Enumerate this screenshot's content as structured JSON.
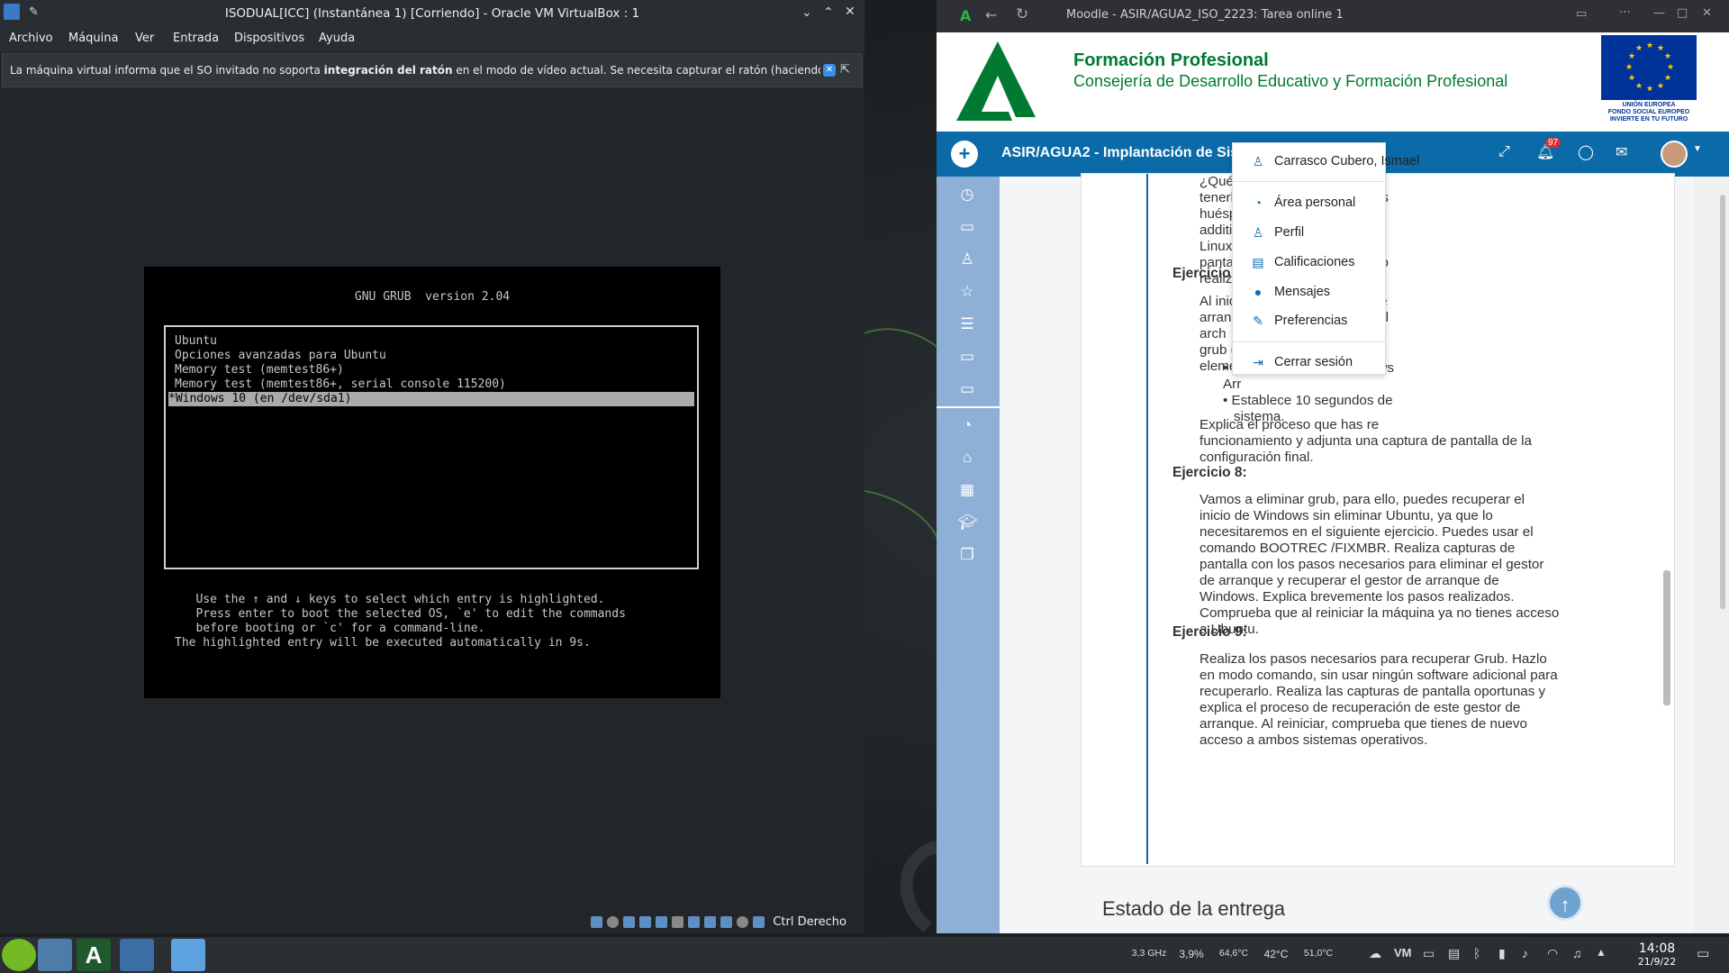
{
  "vbox": {
    "title": "ISODUAL[ICC] (Instantánea 1) [Corriendo] - Oracle VM VirtualBox : 1",
    "menu": [
      "Archivo",
      "Máquina",
      "Ver",
      "Entrada",
      "Dispositivos",
      "Ayuda"
    ],
    "notice_pre": "La máquina virtual informa que el SO invitado no soporta ",
    "notice_bold": "integración del ratón",
    "notice_post": " en el modo de vídeo actual. Se necesita capturar el ratón (haciendo clic sobre la",
    "host_key": "Ctrl Derecho"
  },
  "grub": {
    "header": "GNU GRUB  version 2.04",
    "entries": [
      "Ubuntu",
      "Opciones avanzadas para Ubuntu",
      "Memory test (memtest86+)",
      "Memory test (memtest86+, serial console 115200)",
      "*Windows 10 (en /dev/sda1)"
    ],
    "selected_index": 4,
    "help_lines": [
      "   Use the ↑ and ↓ keys to select which entry is highlighted.",
      "   Press enter to boot the selected OS, `e' to edit the commands",
      "   before booting or `c' for a command-line.",
      "The highlighted entry will be executed automatically in 9s."
    ]
  },
  "browser": {
    "title": "Moodle - ASIR/AGUA2_ISO_2223: Tarea online 1",
    "org_title": "Formación Profesional",
    "org_subtitle": "Consejería de Desarrollo Educativo y Formación Profesional",
    "eu_text_1": "UNIÓN EUROPEA",
    "eu_text_2": "FONDO SOCIAL EUROPEO",
    "eu_text_3": "INVIERTE EN TU FUTURO",
    "course": "ASIR/AGUA2 - Implantación de Sistemas Operativos",
    "notif_count": "97",
    "colors": {
      "nav": "#0b6aa8",
      "sidebar": "#8fb0d6",
      "brand_green": "#007a33"
    }
  },
  "user_menu": {
    "name": "Carrasco Cubero, Ismael",
    "items": [
      "Área personal",
      "Perfil",
      "Calificaciones",
      "Mensajes",
      "Preferencias"
    ],
    "logout": "Cerrar sesión"
  },
  "assignment": {
    "intro_lines": [
      "¿Qué son las guest additions?",
      "tenerlas instaladas en los huésp",
      "additions en ambos sistemas",
      "Linux). Explica brevemente y",
      "pantalla el procedimiento realizado"
    ],
    "ex7_title": "Ejercicio 7:",
    "ex7_lines": [
      "Al iniciar la máquina deberá de",
      "arranque Grub. Entra en el arch",
      "grub (/etc/default/grub) y co",
      "elementos:"
    ],
    "ex7_bullets": [
      "Establece que Windows Arr",
      "Establece 10 segundos de"
    ],
    "ex7_bullet2_cont": "sistema.",
    "ex7_after": [
      "Explica el proceso que has re",
      "funcionamiento y adjunta una captura de pantalla de la",
      "configuración final."
    ],
    "ex8_title": "Ejercicio 8:",
    "ex8_lines": [
      "Vamos a eliminar grub, para ello,  puedes recuperar el",
      "inicio de Windows sin eliminar Ubuntu, ya que lo",
      "necesitaremos en el siguiente ejercicio.  Puedes usar el",
      "comando BOOTREC /FIXMBR.   Realiza capturas de",
      "pantalla con los pasos necesarios para eliminar el gestor",
      "de arranque y recuperar el gestor de arranque de",
      "Windows.  Explica brevemente los pasos realizados.",
      "Comprueba que al reiniciar la máquina ya no tienes acceso",
      "a Ubuntu."
    ],
    "ex9_title": "Ejercicio 9:",
    "ex9_lines": [
      "Realiza los pasos necesarios para recuperar Grub.  Hazlo",
      "en modo comando, sin usar ningún software adicional para",
      "recuperarlo.  Realiza las capturas de pantalla oportunas y",
      "explica el proceso de recuperación de este gestor de",
      "arranque. Al reiniciar, comprueba que tienes de nuevo",
      "acceso a ambos sistemas operativos."
    ],
    "status_heading": "Estado de la entrega"
  },
  "tray": {
    "cpu_freq": "3,3 GHz",
    "cpu_load": "3,9%",
    "temp1": "64,6°C",
    "temp2": "42°C",
    "temp3": "51,0°C",
    "time": "14:08",
    "date": "21/9/22"
  }
}
